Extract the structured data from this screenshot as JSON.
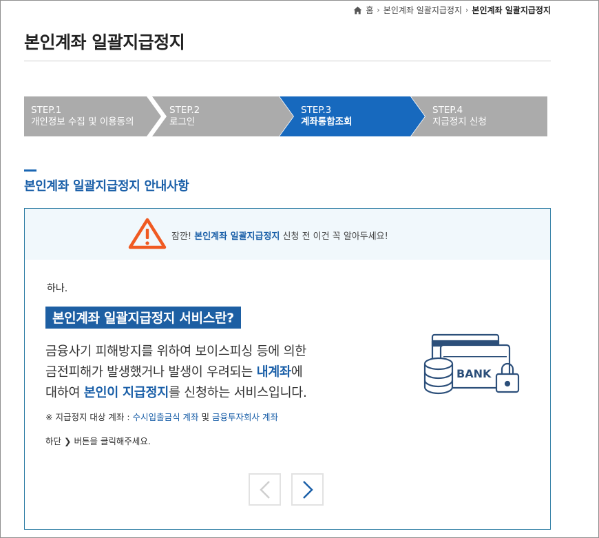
{
  "breadcrumb": {
    "home_icon": "home-icon",
    "home": "홈",
    "level1": "본인계좌 일괄지급정지",
    "current": "본인계좌 일괄지급정지"
  },
  "page_title": "본인계좌 일괄지급정지",
  "steps": [
    {
      "num": "STEP.1",
      "name": "개인정보 수집 및 이용동의",
      "active": false
    },
    {
      "num": "STEP.2",
      "name": "로그인",
      "active": false
    },
    {
      "num": "STEP.3",
      "name": "계좌통합조회",
      "active": true
    },
    {
      "num": "STEP.4",
      "name": "지급정지 신청",
      "active": false
    }
  ],
  "colors": {
    "step_inactive": "#ababab",
    "step_active": "#1769be",
    "accent": "#1a5fa8",
    "warning": "#f05a22",
    "notice_bg": "#f1f8fc",
    "box_border": "#2f7ea5"
  },
  "section_title": "본인계좌 일괄지급정지 안내사항",
  "notice": {
    "icon": "warning-triangle-icon",
    "prefix": "잠깐! ",
    "highlight": "본인계좌 일괄지급정지",
    "suffix": " 신청 전 이건 꼭 알아두세요!"
  },
  "content": {
    "ordinal": "하나.",
    "heading": "본인계좌 일괄지급정지 서비스란?",
    "desc_line1": "금융사기 피해방지를 위하여 보이스피싱 등에 의한",
    "desc_line2_a": "금전피해가 발생했거나 발생이 우려되는 ",
    "desc_line2_b": "내계좌",
    "desc_line2_c": "에",
    "desc_line3_a": "대하여 ",
    "desc_line3_b": "본인이 지급정지",
    "desc_line3_c": "를 신청하는 서비스입니다.",
    "note_prefix": "※ 지급정지 대상 계좌 : ",
    "note_link1": "수시입출금식 계좌",
    "note_mid": " 및 ",
    "note_link2": "금융투자회사 계좌",
    "hint_prefix": "하단 ",
    "hint_suffix": " 버튼을 클릭해주세요.",
    "illustration_label": "BANK"
  },
  "pager": {
    "prev_icon": "chevron-left-icon",
    "next_icon": "chevron-right-icon"
  }
}
